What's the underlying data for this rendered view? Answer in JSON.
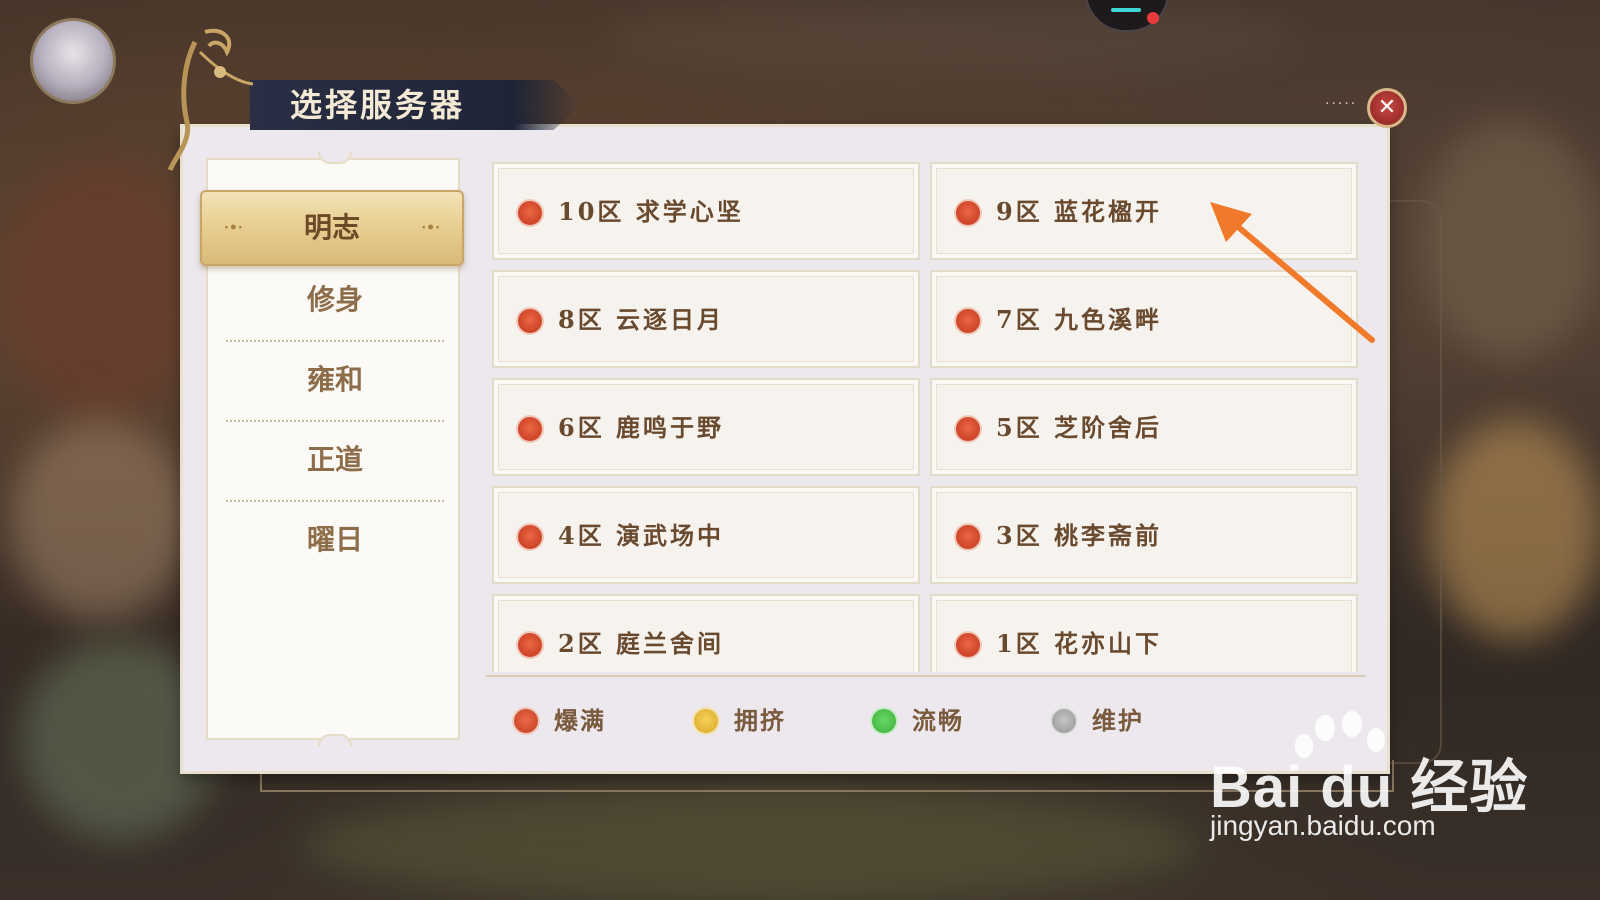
{
  "dialog": {
    "title": "选择服务器"
  },
  "tabs": [
    {
      "label": "明志",
      "active": true
    },
    {
      "label": "修身",
      "active": false
    },
    {
      "label": "雍和",
      "active": false
    },
    {
      "label": "正道",
      "active": false
    },
    {
      "label": "曜日",
      "active": false
    }
  ],
  "servers": [
    {
      "name": "10区 求学心坚",
      "status": "爆满"
    },
    {
      "name": "9区 蓝花楹开",
      "status": "爆满"
    },
    {
      "name": "8区 云逐日月",
      "status": "爆满"
    },
    {
      "name": "7区 九色溪畔",
      "status": "爆满"
    },
    {
      "name": "6区 鹿鸣于野",
      "status": "爆满"
    },
    {
      "name": "5区 芝阶舍后",
      "status": "爆满"
    },
    {
      "name": "4区 演武场中",
      "status": "爆满"
    },
    {
      "name": "3区 桃李斋前",
      "status": "爆满"
    },
    {
      "name": "2区 庭兰舍间",
      "status": "爆满"
    },
    {
      "name": "1区 花亦山下",
      "status": "爆满"
    }
  ],
  "legend": [
    {
      "label": "爆满",
      "color": "#d94a2c"
    },
    {
      "label": "拥挤",
      "color": "#e8b830"
    },
    {
      "label": "流畅",
      "color": "#4cc24a"
    },
    {
      "label": "维护",
      "color": "#a9a9a9"
    }
  ],
  "colors": {
    "full": "#d94a2c",
    "accent_gold": "#e8cf92",
    "text_brown": "#6a4a2f"
  },
  "icons": {
    "close": "close-icon",
    "annotation": "orange-arrow-icon"
  },
  "watermark": {
    "logo_text": "Bai du 经验",
    "url": "jingyan.baidu.com"
  }
}
